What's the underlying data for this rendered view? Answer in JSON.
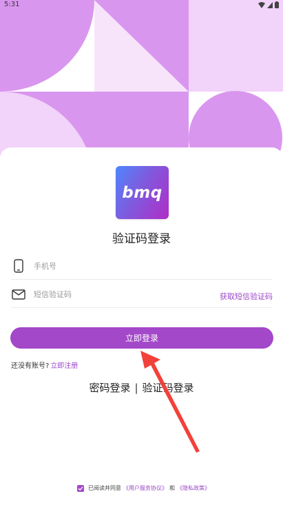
{
  "status_bar": {
    "time": "5:31"
  },
  "logo": {
    "text": "bmq"
  },
  "page_title": "验证码登录",
  "phone_field": {
    "value": "",
    "placeholder": "手机号"
  },
  "code_field": {
    "value": "",
    "placeholder": "短信验证码",
    "get_code_label": "获取短信验证码"
  },
  "login_button": {
    "label": "立即登录"
  },
  "signup": {
    "prompt": "还没有账号?",
    "link": "立即注册"
  },
  "mode_switch": {
    "password_login": "密码登录",
    "separator": "|",
    "code_login": "验证码登录"
  },
  "agreement": {
    "prefix": "已阅读并同意",
    "terms": "《用户服务协议》",
    "and": "和",
    "privacy": "《隐私政策》",
    "checked": true
  },
  "colors": {
    "accent": "#a348c9",
    "link": "#9b47c7",
    "hero_purple": "#d996ee",
    "hero_light": "#f2d3fa",
    "annotation_arrow": "#f2413a"
  },
  "icons": {
    "phone": "phone-icon",
    "mail": "mail-icon",
    "check": "check-icon",
    "wifi": "wifi-icon",
    "signal": "signal-icon",
    "battery": "battery-icon"
  }
}
